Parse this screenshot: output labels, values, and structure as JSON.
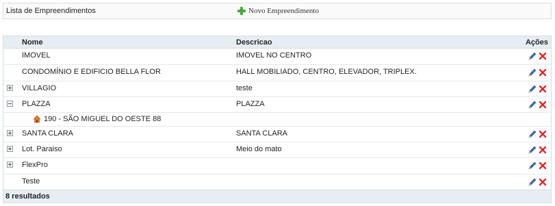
{
  "header": {
    "title": "Lista de Empreendimentos",
    "new_button_label": "Novo Empreendimento"
  },
  "table": {
    "columns": {
      "nome": "Nome",
      "descricao": "Descricao",
      "acoes": "Ações"
    },
    "rows": [
      {
        "nome": "IMOVEL",
        "descricao": "IMOVEL NO CENTRO",
        "expander": "none"
      },
      {
        "nome": "CONDOMÍNIO E EDIFICIO BELLA FLOR",
        "descricao": "HALL MOBILIADO, CENTRO, ELEVADOR, TRIPLEX.",
        "expander": "none"
      },
      {
        "nome": "VILLAGIO",
        "descricao": "teste",
        "expander": "plus"
      },
      {
        "nome": "PLAZZA",
        "descricao": "PLAZZA",
        "expander": "minus"
      },
      {
        "nome": "SANTA CLARA",
        "descricao": "SANTA CLARA",
        "expander": "plus"
      },
      {
        "nome": "Lot. Paraiso",
        "descricao": "Meio do mato",
        "expander": "plus"
      },
      {
        "nome": "FlexPro",
        "descricao": "",
        "expander": "plus"
      },
      {
        "nome": "Teste",
        "descricao": "",
        "expander": "none"
      }
    ],
    "expanded_child": {
      "label": "190 - SÃO MIGUEL DO OESTE 88"
    },
    "footer": "8 resultados"
  },
  "colors": {
    "header_bg": "#e6edf3",
    "plus_green": "#4aa93b",
    "delete_red": "#d62b2b",
    "edit_blue": "#3f6fb3"
  }
}
